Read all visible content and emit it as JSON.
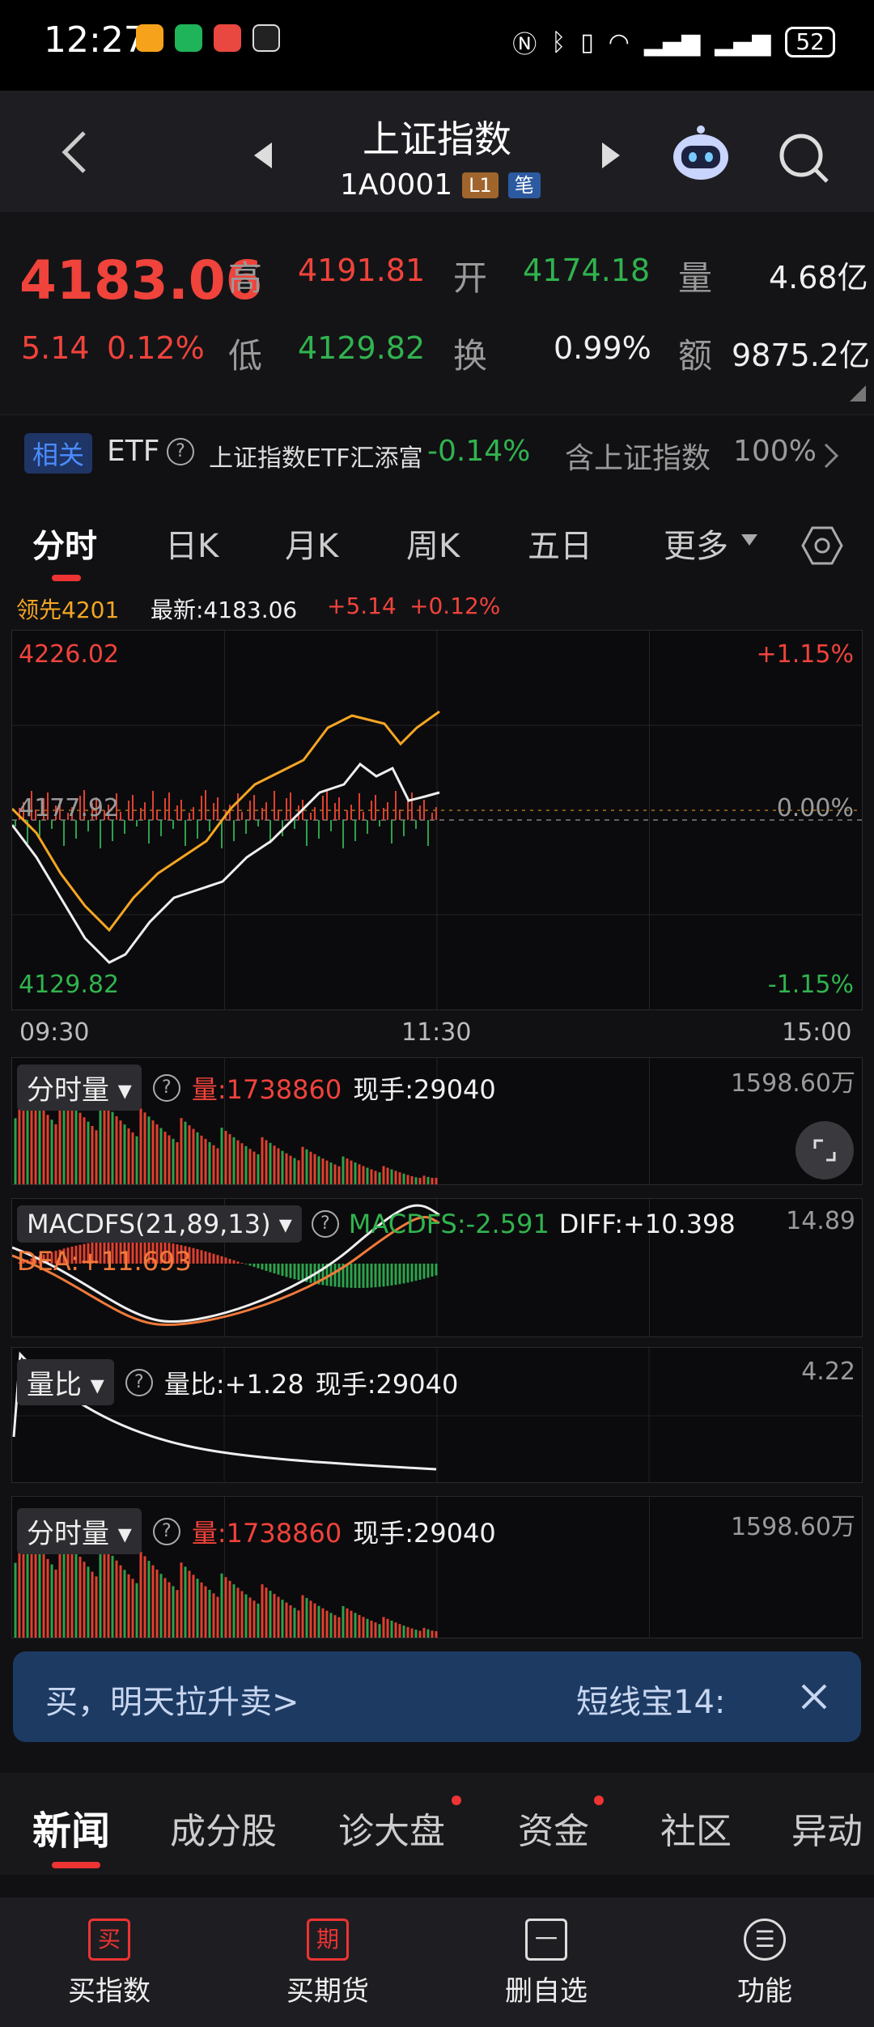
{
  "status": {
    "time": "12:27",
    "battery": "52"
  },
  "header": {
    "title": "上证指数",
    "code": "1A0001",
    "tag_l1": "L1",
    "tag_bi": "笔"
  },
  "quote": {
    "price": "4183.06",
    "change": "5.14",
    "change_pct": "0.12%",
    "high_label": "高",
    "high": "4191.81",
    "open_label": "开",
    "open": "4174.18",
    "vol_label": "量",
    "vol": "4.68亿",
    "low_label": "低",
    "low": "4129.82",
    "turn_label": "换",
    "turn": "0.99%",
    "amt_label": "额",
    "amt": "9875.2亿"
  },
  "etf": {
    "tag": "相关",
    "label": "ETF",
    "name": "上证指数ETF汇添富",
    "pct": "-0.14%",
    "contains": "含上证指数",
    "weight": "100%"
  },
  "tabs": [
    "分时",
    "日K",
    "月K",
    "周K",
    "五日",
    "更多"
  ],
  "info": {
    "lead": "领先4201",
    "latest": "最新:4183.06",
    "chg": "+5.14",
    "pct": "+0.12%"
  },
  "chart_data": {
    "type": "line",
    "y_top": "4226.02",
    "y_mid": "4177.92",
    "y_bot": "4129.82",
    "pct_top": "+1.15%",
    "pct_mid": "0.00%",
    "pct_bot": "-1.15%",
    "x_labels": [
      "09:30",
      "11:30",
      "15:00"
    ]
  },
  "vol_panel": {
    "name": "分时量",
    "vol": "量:1738860",
    "hand": "现手:29040",
    "max": "1598.60万"
  },
  "macd_panel": {
    "name": "MACDFS(21,89,13)",
    "macdfs": "MACDFS:-2.591",
    "diff": "DIFF:+10.398",
    "dea": "DEA:+11.693",
    "max": "14.89"
  },
  "ratio_panel": {
    "name": "量比",
    "ratio": "量比:+1.28",
    "hand": "现手:29040",
    "max": "4.22"
  },
  "vol2_panel": {
    "name": "分时量",
    "vol": "量:1738860",
    "hand": "现手:29040",
    "max": "1598.60万"
  },
  "banner": {
    "left": "买，明天拉升卖>",
    "right": "短线宝14:"
  },
  "news_tabs": [
    "新闻",
    "成分股",
    "诊大盘",
    "资金",
    "社区",
    "异动"
  ],
  "nav": [
    {
      "icon": "买",
      "label": "买指数"
    },
    {
      "icon": "期",
      "label": "买期货"
    },
    {
      "icon": "一",
      "label": "删自选"
    },
    {
      "icon": "☰",
      "label": "功能"
    }
  ]
}
